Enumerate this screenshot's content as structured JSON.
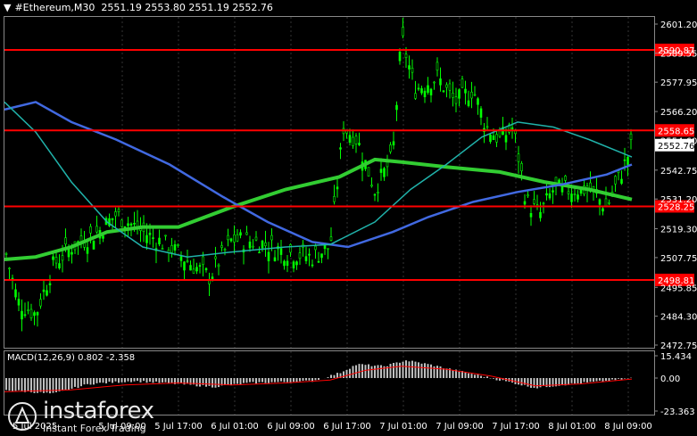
{
  "header": {
    "arrow": "▼",
    "symbol": "#Ethereum,M30",
    "ohlc": "2551.19 2553.80 2551.19 2552.76"
  },
  "price_axis": {
    "ticks": [
      "2601.20",
      "2589.55",
      "2577.95",
      "2566.20",
      "2554.60",
      "2542.75",
      "2531.20",
      "2519.30",
      "2507.75",
      "2495.85",
      "2484.30",
      "2472.75"
    ],
    "current_price": "2552.76"
  },
  "levels": [
    {
      "label": "2590.87",
      "value": 2590.87,
      "color": "#ff0000"
    },
    {
      "label": "2558.65",
      "value": 2558.65,
      "color": "#ff0000"
    },
    {
      "label": "2528.25",
      "value": 2528.25,
      "color": "#ff0000"
    },
    {
      "label": "2498.81",
      "value": 2498.81,
      "color": "#ff0000"
    }
  ],
  "time_axis": [
    "5 Jul 2025",
    "5 Jul 09:00",
    "5 Jul 17:00",
    "6 Jul 01:00",
    "6 Jul 09:00",
    "6 Jul 17:00",
    "7 Jul 01:00",
    "7 Jul 09:00",
    "7 Jul 17:00",
    "8 Jul 01:00",
    "8 Jul 09:00"
  ],
  "macd": {
    "label": "MACD(12,26,9) 0.802 -2.358",
    "ticks": [
      "15.434",
      "0.00",
      "-23.363"
    ]
  },
  "watermark": {
    "brand": "instaforex",
    "tagline": "Instant Forex Trading"
  },
  "colors": {
    "bull_candle": "#00ff00",
    "ma_blue": "#4169e1",
    "ma_teal": "#20b2aa",
    "ma_green": "#32cd32",
    "level": "#ff0000",
    "macd_hist": "#c0c0c0",
    "macd_signal": "#ff0000"
  },
  "chart_data": {
    "type": "line",
    "title": "#Ethereum,M30",
    "ylim": [
      2472.75,
      2601.2
    ],
    "x": [
      "5 Jul 2025",
      "5 Jul 09:00",
      "5 Jul 17:00",
      "6 Jul 01:00",
      "6 Jul 09:00",
      "6 Jul 17:00",
      "7 Jul 01:00",
      "7 Jul 09:00",
      "7 Jul 17:00",
      "8 Jul 01:00",
      "8 Jul 09:00"
    ],
    "series": [
      {
        "name": "close",
        "values": [
          2512,
          2500,
          2516,
          2515,
          2510,
          2560,
          2590,
          2570,
          2540,
          2530,
          2552.76
        ]
      },
      {
        "name": "blue",
        "values": [
          2570,
          2556,
          2540,
          2524,
          2514,
          2512,
          2526,
          2536,
          2538,
          2544,
          2546
        ]
      },
      {
        "name": "green",
        "values": [
          2512,
          2516,
          2520,
          2526,
          2532,
          2540,
          2546,
          2544,
          2540,
          2534,
          2531
        ]
      }
    ]
  }
}
